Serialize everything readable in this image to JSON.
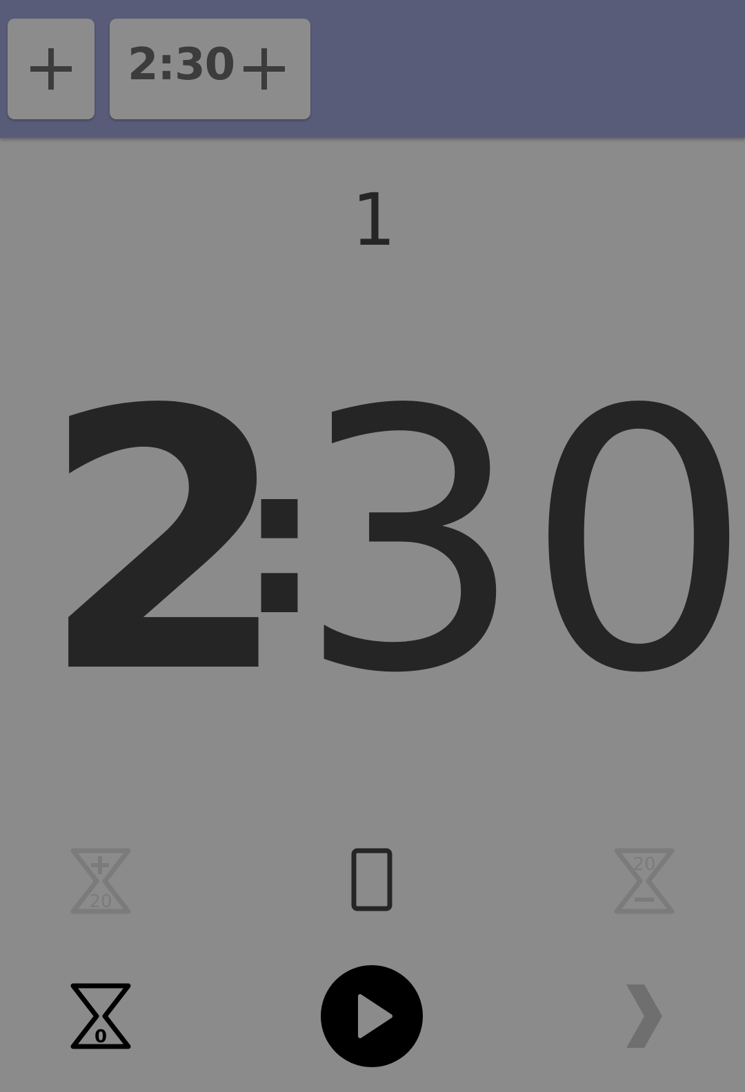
{
  "toolbar": {
    "add_label": "+",
    "preset": {
      "time": "2:30",
      "add_label": "+"
    }
  },
  "round": "1",
  "timer": {
    "minutes": "2",
    "separator": ":",
    "seconds": "30"
  },
  "controls": {
    "add_time_amount": "20",
    "subtract_time_amount": "20",
    "reset_value": "0"
  },
  "colors": {
    "topbar": "#585c78",
    "background": "#8b8b8b",
    "text": "#252525"
  }
}
